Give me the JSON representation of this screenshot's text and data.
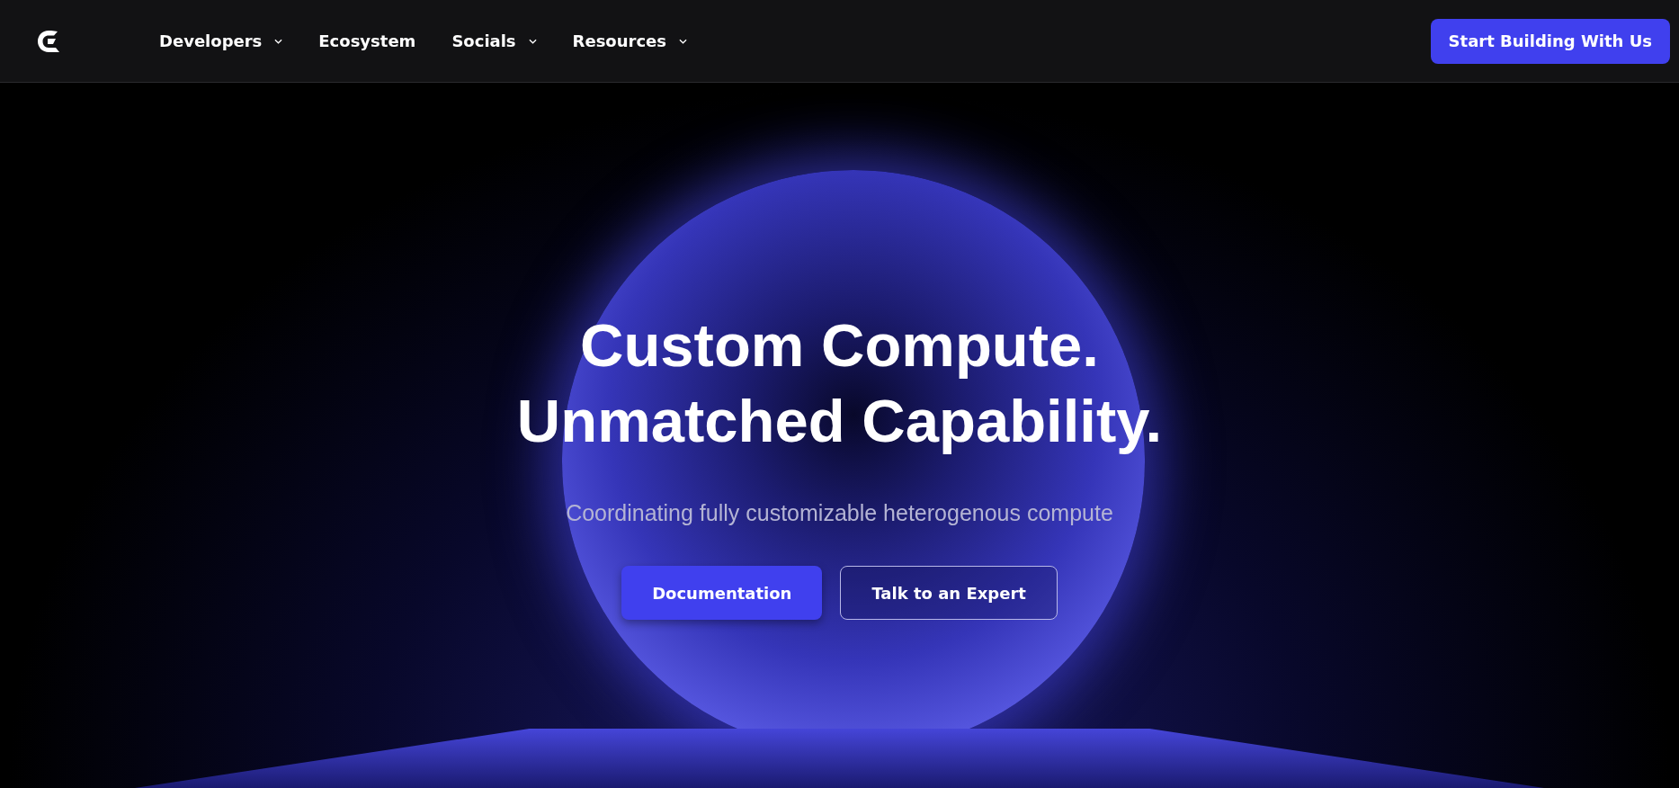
{
  "nav": {
    "items": [
      {
        "label": "Developers",
        "dropdown": true
      },
      {
        "label": "Ecosystem",
        "dropdown": false
      },
      {
        "label": "Socials",
        "dropdown": true
      },
      {
        "label": "Resources",
        "dropdown": true
      }
    ],
    "cta": "Start Building With Us"
  },
  "hero": {
    "headline": [
      "Custom Compute.",
      "Unmatched Capability."
    ],
    "subtitle": "Coordinating fully customizable heterogenous compute",
    "buttons": [
      {
        "label": "Documentation",
        "kind": "primary"
      },
      {
        "label": "Talk to an Expert",
        "kind": "outline"
      }
    ]
  }
}
